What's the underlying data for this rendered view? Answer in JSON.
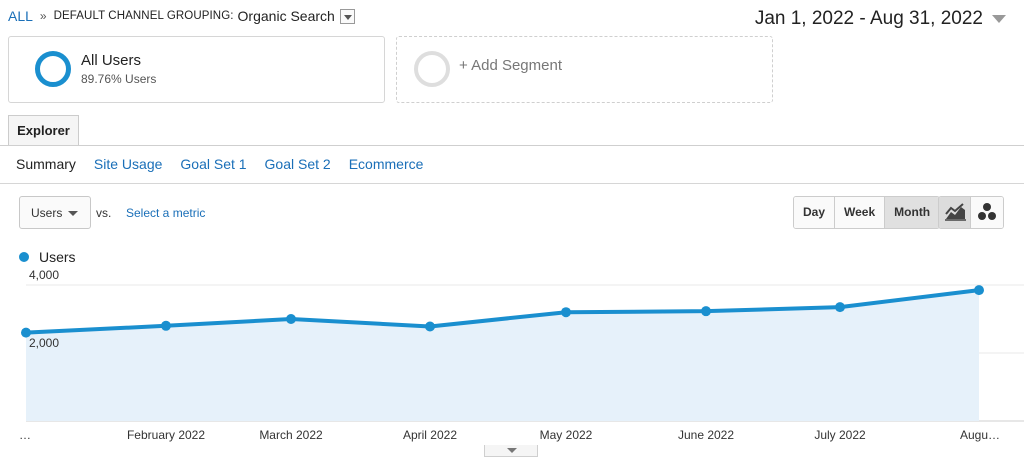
{
  "breadcrumb": {
    "all": "ALL",
    "separator": "»",
    "dimension": "DEFAULT CHANNEL GROUPING:",
    "value": "Organic Search"
  },
  "date_range": "Jan 1, 2022 - Aug 31, 2022",
  "segments": {
    "all_users": {
      "title": "All Users",
      "subtitle": "89.76% Users"
    },
    "add_segment": "+ Add Segment"
  },
  "tab": "Explorer",
  "subtabs": [
    {
      "label": "Summary",
      "active": true
    },
    {
      "label": "Site Usage"
    },
    {
      "label": "Goal Set 1"
    },
    {
      "label": "Goal Set 2"
    },
    {
      "label": "Ecommerce"
    }
  ],
  "metric": {
    "selected": "Users",
    "vs": "vs.",
    "select_metric": "Select a metric"
  },
  "period_buttons": [
    {
      "label": "Day"
    },
    {
      "label": "Week"
    },
    {
      "label": "Month",
      "active": true
    }
  ],
  "view_icons": [
    "line-chart-icon",
    "motion-chart-icon"
  ],
  "legend": "Users",
  "colors": {
    "series": "#1a8fcf",
    "fill": "#e6f1fa",
    "link": "#1a6fb8"
  },
  "chart_data": {
    "type": "area",
    "x": [
      "…",
      "February 2022",
      "March 2022",
      "April 2022",
      "May 2022",
      "June 2022",
      "July 2022",
      "Augu…"
    ],
    "series": [
      {
        "name": "Users",
        "values": [
          2600,
          2800,
          3000,
          2780,
          3200,
          3230,
          3350,
          3850
        ]
      }
    ],
    "y_ticks": [
      {
        "value": 4000,
        "label": "4,000"
      },
      {
        "value": 2000,
        "label": "2,000"
      }
    ],
    "ylim": [
      0,
      4000
    ],
    "grid": true
  }
}
